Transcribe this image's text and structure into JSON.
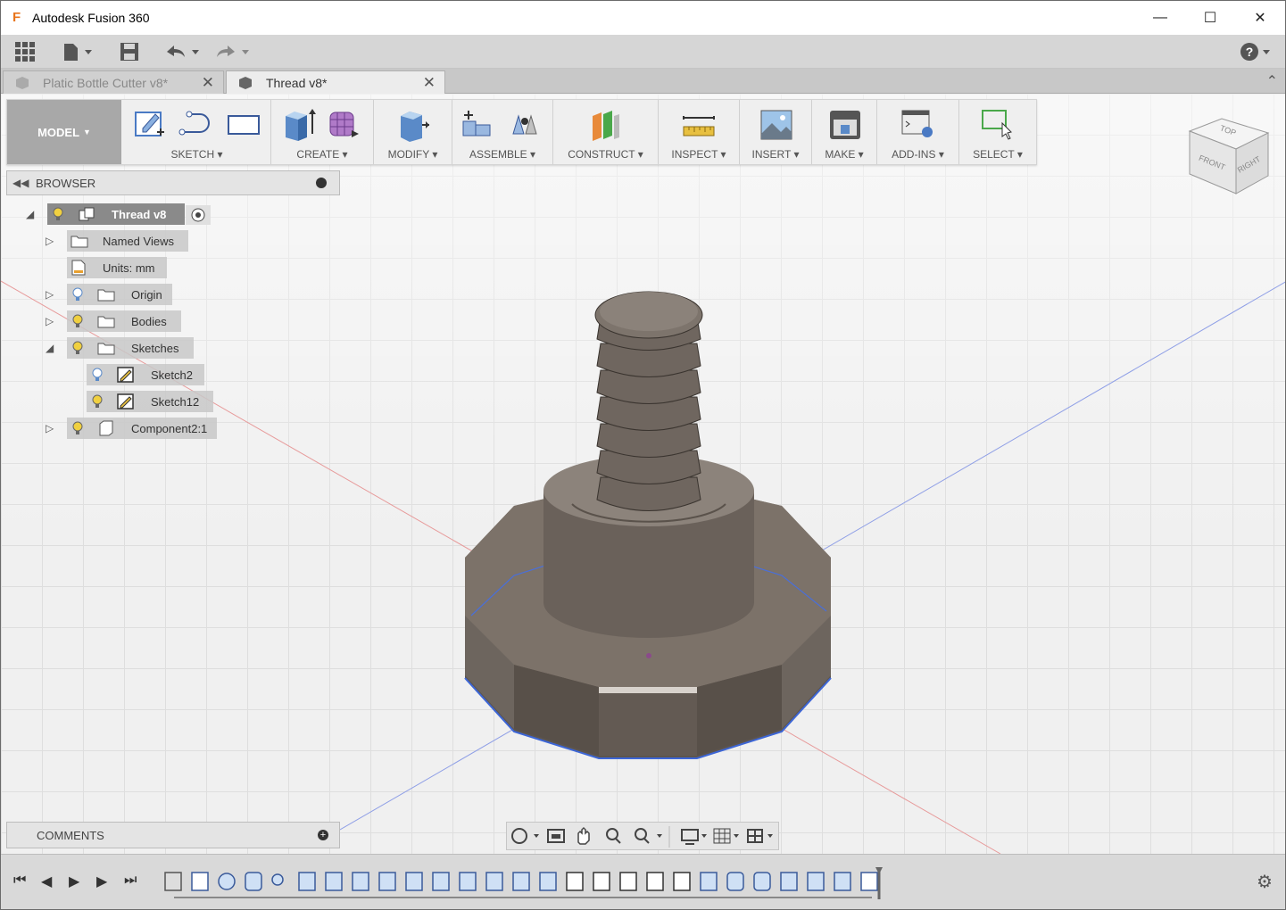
{
  "window": {
    "title": "Autodesk Fusion 360",
    "logo_letter": "F"
  },
  "tabs": [
    {
      "label": "Platic Bottle Cutter v8*",
      "active": false
    },
    {
      "label": "Thread v8*",
      "active": true
    }
  ],
  "toolbar": {
    "workspace": "MODEL",
    "groups": [
      "SKETCH",
      "CREATE",
      "MODIFY",
      "ASSEMBLE",
      "CONSTRUCT",
      "INSPECT",
      "INSERT",
      "MAKE",
      "ADD-INS",
      "SELECT"
    ]
  },
  "browser": {
    "title": "BROWSER",
    "root": "Thread v8",
    "items": [
      {
        "label": "Named Views"
      },
      {
        "label": "Units: mm"
      },
      {
        "label": "Origin"
      },
      {
        "label": "Bodies"
      },
      {
        "label": "Sketches"
      },
      {
        "label": "Sketch2"
      },
      {
        "label": "Sketch12"
      },
      {
        "label": "Component2:1"
      }
    ]
  },
  "comments": {
    "title": "COMMENTS"
  },
  "viewcube": {
    "top": "TOP",
    "front": "FRONT",
    "right": "RIGHT"
  },
  "colors": {
    "accent": "#e8741b",
    "viewport": "#f0f0f0",
    "model": "#6e655d"
  }
}
